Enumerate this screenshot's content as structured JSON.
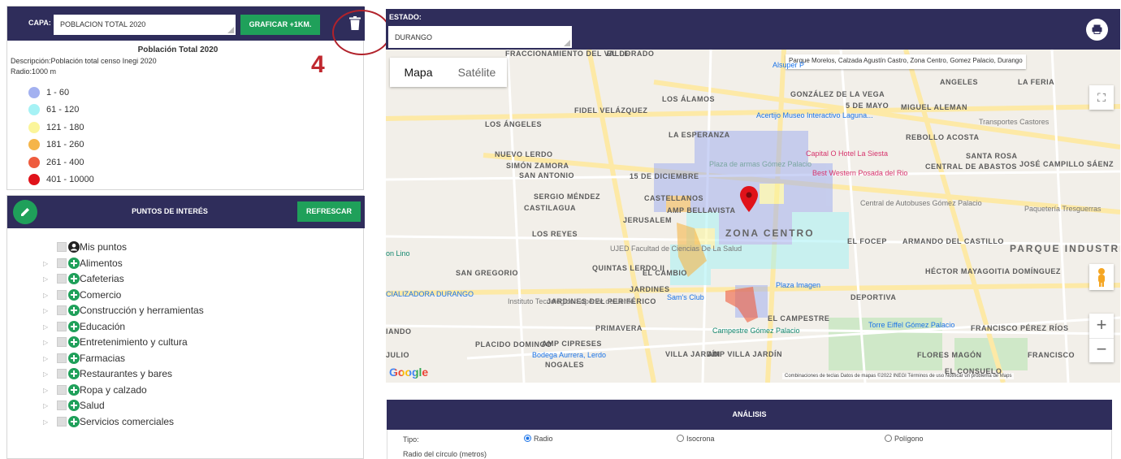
{
  "capa": {
    "label": "CAPA:",
    "selected": "POBLACION TOTAL 2020",
    "graficar_label": "GRAFICAR +1KM.",
    "annotation_number": "4"
  },
  "legend": {
    "title": "Población Total 2020",
    "description": "Descripción:Población total censo Inegi 2020",
    "radius": "Radio:1000 m",
    "items": [
      {
        "label": "1 - 60",
        "color": "#a3b1f0"
      },
      {
        "label": "61 - 120",
        "color": "#a6f2f5"
      },
      {
        "label": "121 - 180",
        "color": "#fbf59a"
      },
      {
        "label": "181 - 260",
        "color": "#f5b54a"
      },
      {
        "label": "261 - 400",
        "color": "#ee5c3e"
      },
      {
        "label": "401 - 10000",
        "color": "#e0121a"
      }
    ]
  },
  "poi": {
    "title": "PUNTOS DE INTERÉS",
    "refresh_label": "REFRESCAR",
    "items": [
      {
        "label": "Mis puntos",
        "kind": "user"
      },
      {
        "label": "Alimentos",
        "kind": "plus"
      },
      {
        "label": "Cafeterias",
        "kind": "plus"
      },
      {
        "label": "Comercio",
        "kind": "plus"
      },
      {
        "label": "Construcción y herramientas",
        "kind": "plus"
      },
      {
        "label": "Educación",
        "kind": "plus"
      },
      {
        "label": "Entretenimiento y cultura",
        "kind": "plus"
      },
      {
        "label": "Farmacias",
        "kind": "plus"
      },
      {
        "label": "Restaurantes y bares",
        "kind": "plus"
      },
      {
        "label": "Ropa y calzado",
        "kind": "plus"
      },
      {
        "label": "Salud",
        "kind": "plus"
      },
      {
        "label": "Servicios comerciales",
        "kind": "plus"
      }
    ]
  },
  "estado": {
    "label": "ESTADO:",
    "selected": "DURANGO"
  },
  "map": {
    "tab_map": "Mapa",
    "tab_satellite": "Satélite",
    "tooltip": "Parque Morelos, Calzada Agustín Castro, Zona Centro, Gomez Palacio, Durango",
    "google": "Google",
    "footer": "Combinaciones de teclas   Datos de mapas ©2022 INEGI   Términos de uso   Notificar un problema de Maps",
    "labels": [
      "FRACCIONAMIENTO DEL VALLE",
      "EL DORADO",
      "LOS ÁLAMOS",
      "GONZÁLEZ DE LA VEGA",
      "FIDEL VELÁZQUEZ",
      "LOS ÁNGELES",
      "ANGELES",
      "LA FERIA",
      "5 DE MAYO",
      "MIGUEL ALEMAN",
      "LA ESPERANZA",
      "REBOLLO ACOSTA",
      "NUEVO LERDO",
      "SIMÓN ZAMORA",
      "SAN ANTONIO",
      "15 DE DICIEMBRE",
      "SANTA ROSA",
      "CENTRAL DE ABASTOS",
      "JOSÉ CAMPILLO SÁENZ",
      "SERGIO MÉNDEZ",
      "CASTILAGUA",
      "CASTELLANOS",
      "AMP BELLAVISTA",
      "JERUSALEM",
      "LOS REYES",
      "ZONA CENTRO",
      "EL FOCEP",
      "ARMANDO DEL CASTILLO",
      "PARQUE INDUSTRIAL",
      "SAN GREGORIO",
      "QUINTAS LERDO II",
      "EL CAMBIO",
      "HÉCTOR MAYAGOITIA DOMÍNGUEZ",
      "JARDINES",
      "DEPORTIVA",
      "JARDINES DEL PERIFÉRICO",
      "EL CAMPESTRE",
      "PRIMAVERA",
      "FRANCISCO PÉREZ RÍOS",
      "PLACIDO DOMINGO",
      "AMP CIPRESES",
      "VILLA JARDÍN",
      "AMP VILLA JARDÍN",
      "FLORES MAGÓN",
      "FRANCISCO",
      "NOGALES",
      "JULIO",
      "IANDO",
      "EL CONSUELO"
    ],
    "pois": [
      "Alsuper P",
      "Acertijo Museo Interactivo Laguna...",
      "Transportes Castores",
      "Capital O Hotel La Siesta",
      "Plaza de armas Gómez Palacio",
      "Best Western Posada del Rio",
      "Central de Autobuses Gómez Palacio",
      "Paquetería Tresguerras",
      "UJED Facultad de Ciencias De La Salud",
      "Plaza Imagen",
      "Sam's Club",
      "Instituto Tecnológico Superior de Lerdo",
      "Campestre Gómez Palacio",
      "Torre Eiffel Gómez Palacio",
      "Bodega Aurrera, Lerdo",
      "on Lino",
      "CIALIZADORA DURANGO"
    ]
  },
  "analisis": {
    "title": "ANÁLISIS",
    "tipo_label": "Tipo:",
    "options": [
      "Radio",
      "Isocrona",
      "Polígono"
    ],
    "selected": "Radio",
    "radius_label": "Radio del círculo (metros)"
  }
}
